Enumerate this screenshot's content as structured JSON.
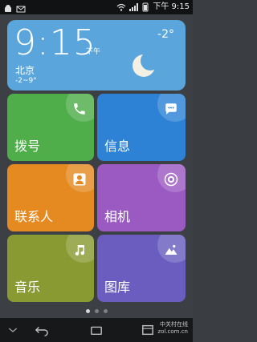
{
  "status_bar": {
    "time": "下午 9:15",
    "left_icons": [
      "android-icon",
      "email-icon"
    ],
    "right_icons": [
      "wifi-icon",
      "signal-icon",
      "battery-icon"
    ]
  },
  "weather_widget": {
    "time": "9:15",
    "ampm": "下午",
    "city": "北京",
    "range": "-2~9°",
    "temperature": "-2°",
    "condition_icon": "moon-icon"
  },
  "tiles": [
    {
      "label": "拨号",
      "icon": "phone-icon",
      "color": "#4fae4a"
    },
    {
      "label": "信息",
      "icon": "message-icon",
      "color": "#2d82d6"
    },
    {
      "label": "联系人",
      "icon": "contact-icon",
      "color": "#e58a21"
    },
    {
      "label": "相机",
      "icon": "camera-icon",
      "color": "#9b5ac2"
    },
    {
      "label": "音乐",
      "icon": "music-icon",
      "color": "#8a9a32"
    },
    {
      "label": "图库",
      "icon": "gallery-icon",
      "color": "#6a5dbf"
    }
  ],
  "pager": {
    "pages": 3,
    "active_index": 0
  },
  "nav_bar": {
    "buttons": [
      "menu-down-icon",
      "back-icon",
      "home-icon",
      "recents-icon"
    ],
    "watermark": [
      "中关村在线",
      "zol.com.cn"
    ]
  }
}
